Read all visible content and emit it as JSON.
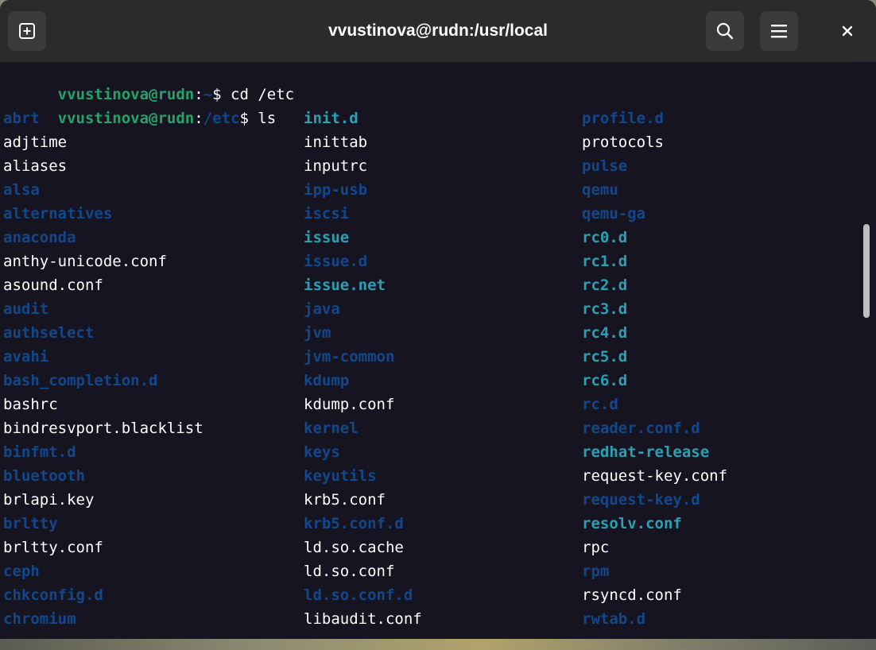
{
  "window": {
    "title": "vvustinova@rudn:/usr/local"
  },
  "icons": {
    "new_tab": "new-tab-plus-icon",
    "search": "search-icon",
    "menu": "hamburger-menu-icon",
    "close": "close-icon"
  },
  "colors": {
    "terminal_bg": "#171421",
    "prompt_user": "#26a269",
    "prompt_path": "#12488b",
    "file": "#ffffff",
    "directory": "#12488b",
    "cyan": "#2aa1b3"
  },
  "terminal": {
    "history": [
      {
        "user": "vvustinova@rudn",
        "path": "~",
        "symbol": "$",
        "command": " cd /etc"
      },
      {
        "user": "vvustinova@rudn",
        "path": "/etc",
        "symbol": "$",
        "command": " ls"
      }
    ],
    "listing": [
      [
        {
          "name": "abrt",
          "type": "dir"
        },
        {
          "name": "init.d",
          "type": "cyan"
        },
        {
          "name": "profile.d",
          "type": "dir"
        }
      ],
      [
        {
          "name": "adjtime",
          "type": "file"
        },
        {
          "name": "inittab",
          "type": "file"
        },
        {
          "name": "protocols",
          "type": "file"
        }
      ],
      [
        {
          "name": "aliases",
          "type": "file"
        },
        {
          "name": "inputrc",
          "type": "file"
        },
        {
          "name": "pulse",
          "type": "dir"
        }
      ],
      [
        {
          "name": "alsa",
          "type": "dir"
        },
        {
          "name": "ipp-usb",
          "type": "dir"
        },
        {
          "name": "qemu",
          "type": "dir"
        }
      ],
      [
        {
          "name": "alternatives",
          "type": "dir"
        },
        {
          "name": "iscsi",
          "type": "dir"
        },
        {
          "name": "qemu-ga",
          "type": "dir"
        }
      ],
      [
        {
          "name": "anaconda",
          "type": "dir"
        },
        {
          "name": "issue",
          "type": "cyan"
        },
        {
          "name": "rc0.d",
          "type": "cyan"
        }
      ],
      [
        {
          "name": "anthy-unicode.conf",
          "type": "file"
        },
        {
          "name": "issue.d",
          "type": "dir"
        },
        {
          "name": "rc1.d",
          "type": "cyan"
        }
      ],
      [
        {
          "name": "asound.conf",
          "type": "file"
        },
        {
          "name": "issue.net",
          "type": "cyan"
        },
        {
          "name": "rc2.d",
          "type": "cyan"
        }
      ],
      [
        {
          "name": "audit",
          "type": "dir"
        },
        {
          "name": "java",
          "type": "dir"
        },
        {
          "name": "rc3.d",
          "type": "cyan"
        }
      ],
      [
        {
          "name": "authselect",
          "type": "dir"
        },
        {
          "name": "jvm",
          "type": "dir"
        },
        {
          "name": "rc4.d",
          "type": "cyan"
        }
      ],
      [
        {
          "name": "avahi",
          "type": "dir"
        },
        {
          "name": "jvm-common",
          "type": "dir"
        },
        {
          "name": "rc5.d",
          "type": "cyan"
        }
      ],
      [
        {
          "name": "bash_completion.d",
          "type": "dir"
        },
        {
          "name": "kdump",
          "type": "dir"
        },
        {
          "name": "rc6.d",
          "type": "cyan"
        }
      ],
      [
        {
          "name": "bashrc",
          "type": "file"
        },
        {
          "name": "kdump.conf",
          "type": "file"
        },
        {
          "name": "rc.d",
          "type": "dir"
        }
      ],
      [
        {
          "name": "bindresvport.blacklist",
          "type": "file"
        },
        {
          "name": "kernel",
          "type": "dir"
        },
        {
          "name": "reader.conf.d",
          "type": "dir"
        }
      ],
      [
        {
          "name": "binfmt.d",
          "type": "dir"
        },
        {
          "name": "keys",
          "type": "dir"
        },
        {
          "name": "redhat-release",
          "type": "cyan"
        }
      ],
      [
        {
          "name": "bluetooth",
          "type": "dir"
        },
        {
          "name": "keyutils",
          "type": "dir"
        },
        {
          "name": "request-key.conf",
          "type": "file"
        }
      ],
      [
        {
          "name": "brlapi.key",
          "type": "file"
        },
        {
          "name": "krb5.conf",
          "type": "file"
        },
        {
          "name": "request-key.d",
          "type": "dir"
        }
      ],
      [
        {
          "name": "brltty",
          "type": "dir"
        },
        {
          "name": "krb5.conf.d",
          "type": "dir"
        },
        {
          "name": "resolv.conf",
          "type": "cyan"
        }
      ],
      [
        {
          "name": "brltty.conf",
          "type": "file"
        },
        {
          "name": "ld.so.cache",
          "type": "file"
        },
        {
          "name": "rpc",
          "type": "file"
        }
      ],
      [
        {
          "name": "ceph",
          "type": "dir"
        },
        {
          "name": "ld.so.conf",
          "type": "file"
        },
        {
          "name": "rpm",
          "type": "dir"
        }
      ],
      [
        {
          "name": "chkconfig.d",
          "type": "dir"
        },
        {
          "name": "ld.so.conf.d",
          "type": "dir"
        },
        {
          "name": "rsyncd.conf",
          "type": "file"
        }
      ],
      [
        {
          "name": "chromium",
          "type": "dir"
        },
        {
          "name": "libaudit.conf",
          "type": "file"
        },
        {
          "name": "rwtab.d",
          "type": "dir"
        }
      ]
    ]
  }
}
